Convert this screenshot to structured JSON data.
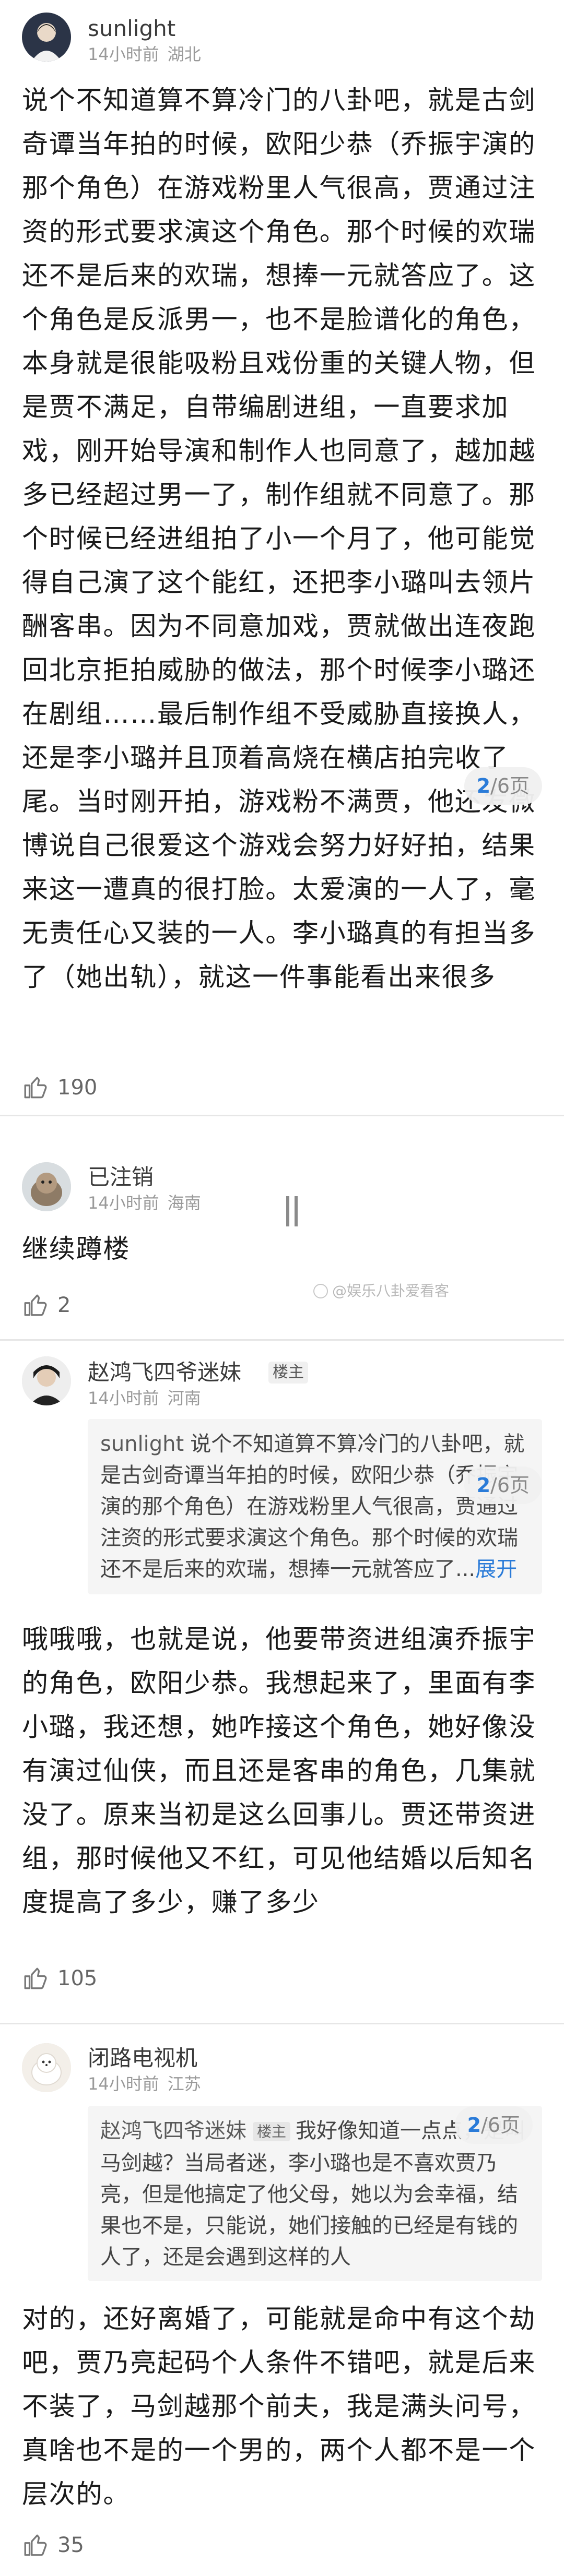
{
  "posts": [
    {
      "username": "sunlight",
      "time": "14小时前",
      "location": "湖北",
      "content": "说个不知道算不算冷门的八卦吧，就是古剑奇谭当年拍的时候，欧阳少恭（乔振宇演的那个角色）在游戏粉里人气很高，贾通过注资的形式要求演这个角色。那个时候的欢瑞还不是后来的欢瑞，想捧一元就答应了。这个角色是反派男一，也不是脸谱化的角色，本身就是很能吸粉且戏份重的关键人物，但是贾不满足，自带编剧进组，一直要求加戏，刚开始导演和制作人也同意了，越加越多已经超过男一了，制作组就不同意了。那个时候已经进组拍了小一个月了，他可能觉得自己演了这个能红，还把李小璐叫去领片酬客串。因为不同意加戏，贾就做出连夜跑回北京拒拍威胁的做法，那个时候李小璐还在剧组……最后制作组不受威胁直接换人，还是李小璐并且顶着高烧在横店拍完收了尾。当时刚开拍，游戏粉不满贾，他还发微博说自己很爱这个游戏会努力好好拍，结果来这一遭真的很打脸。太爱演的一人了，毫无责任心又装的一人。李小璐真的有担当多了（她出轨），就这一件事能看出来很多",
      "likes": "190"
    },
    {
      "username": "已注销",
      "time": "14小时前",
      "location": "海南",
      "content": "继续蹲楼",
      "likes": "2"
    },
    {
      "username": "赵鸿飞四爷迷妹",
      "badge": "楼主",
      "time": "14小时前",
      "location": "河南",
      "quote": {
        "author": "sunlight",
        "text": "说个不知道算不算冷门的八卦吧，就是古剑奇谭当年拍的时候，欧阳少恭（乔振宇演的那个角色）在游戏粉里人气很高，贾通过注资的形式要求演这个角色。那个时候的欢瑞还不是后来的欢瑞，想捧一元就答应了...",
        "expand": "展开"
      },
      "content": "哦哦哦，也就是说，他要带资进组演乔振宇的角色，欧阳少恭。我想起来了，里面有李小璐，我还想，她咋接这个角色，她好像没有演过仙侠，而且还是客串的角色，几集就没了。原来当初是这么回事儿。贾还带资进组，那时候他又不红，可见他结婚以后知名度提高了多少，赚了多少",
      "likes": "105"
    },
    {
      "username": "闭路电视机",
      "time": "14小时前",
      "location": "江苏",
      "quote": {
        "author": "赵鸿飞四爷迷妹",
        "badge": "楼主",
        "text": "我好像知道一点点，是叫马剑越？当局者迷，李小璐也是不喜欢贾乃亮，但是他搞定了他父母，她以为会幸福，结果也不是，只能说，她们接触的已经是有钱的人了，还是会遇到这样的人"
      },
      "content": "对的，还好离婚了，可能就是命中有这个劫吧，贾乃亮起码个人条件不错吧，就是后来不装了，马剑越那个前夫，我是满头问号，真啥也不是的一个男的，两个人都不是一个层次的。",
      "likes": "35"
    }
  ],
  "page_indicator": {
    "current": "2",
    "total": "/6页"
  },
  "watermark": "@娱乐八卦爱看客"
}
